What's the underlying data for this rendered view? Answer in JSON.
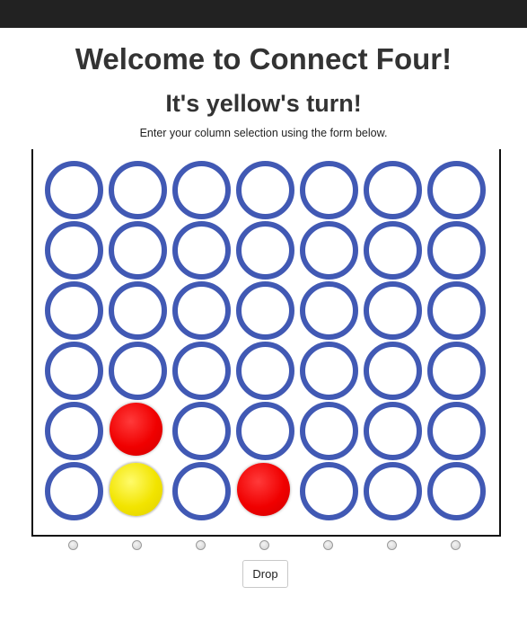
{
  "header": {
    "title": "Welcome to Connect Four!",
    "turn_message": "It's yellow's turn!",
    "instructions": "Enter your column selection using the form below."
  },
  "board": {
    "rows": 6,
    "columns": 7,
    "hole_color": "#4159b4",
    "cells": [
      [
        "empty",
        "empty",
        "empty",
        "empty",
        "empty",
        "empty",
        "empty"
      ],
      [
        "empty",
        "empty",
        "empty",
        "empty",
        "empty",
        "empty",
        "empty"
      ],
      [
        "empty",
        "empty",
        "empty",
        "empty",
        "empty",
        "empty",
        "empty"
      ],
      [
        "empty",
        "empty",
        "empty",
        "empty",
        "empty",
        "empty",
        "empty"
      ],
      [
        "empty",
        "red",
        "empty",
        "empty",
        "empty",
        "empty",
        "empty"
      ],
      [
        "empty",
        "yellow",
        "empty",
        "red",
        "empty",
        "empty",
        "empty"
      ]
    ]
  },
  "form": {
    "column_options": [
      1,
      2,
      3,
      4,
      5,
      6,
      7
    ],
    "selected_column": null,
    "drop_label": "Drop"
  }
}
